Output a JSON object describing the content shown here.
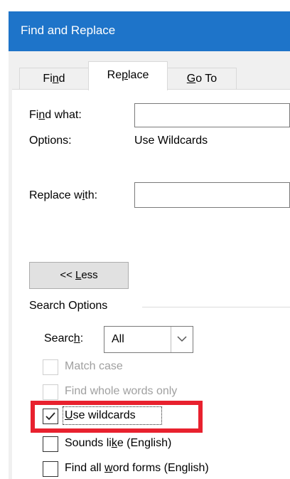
{
  "dialog": {
    "title": "Find and Replace",
    "tabs": {
      "find": {
        "pre": "Fi",
        "key": "n",
        "post": "d"
      },
      "replace": {
        "pre": "Re",
        "key": "p",
        "post": "lace"
      },
      "goto": {
        "key": "G",
        "post": "o To"
      }
    }
  },
  "find": {
    "label_pre": "Fi",
    "label_key": "n",
    "label_post": "d what:",
    "value": ""
  },
  "options": {
    "label": "Options:",
    "value": "Use Wildcards"
  },
  "replace": {
    "label_pre": "Replace w",
    "label_key": "i",
    "label_post": "th:",
    "value": ""
  },
  "less_button": {
    "pre": "<< ",
    "key": "L",
    "post": "ess"
  },
  "search_options": {
    "heading": "Search Options",
    "search_label_pre": "Searc",
    "search_label_key": "h",
    "search_label_post": ":",
    "search_value": "All",
    "checkboxes": [
      {
        "label": "Match case",
        "checked": false,
        "enabled": false
      },
      {
        "label": "Find whole words only",
        "checked": false,
        "enabled": false
      },
      {
        "key": "U",
        "label_rest": "se wildcards",
        "checked": true,
        "enabled": true
      },
      {
        "pre": "Sounds li",
        "key": "k",
        "post": "e (English)",
        "checked": false,
        "enabled": true
      },
      {
        "pre": "Find all ",
        "key": "w",
        "post": "ord forms (English)",
        "checked": false,
        "enabled": true
      }
    ]
  },
  "colors": {
    "titlebar": "#1e74c9",
    "highlight": "#e8212e"
  }
}
